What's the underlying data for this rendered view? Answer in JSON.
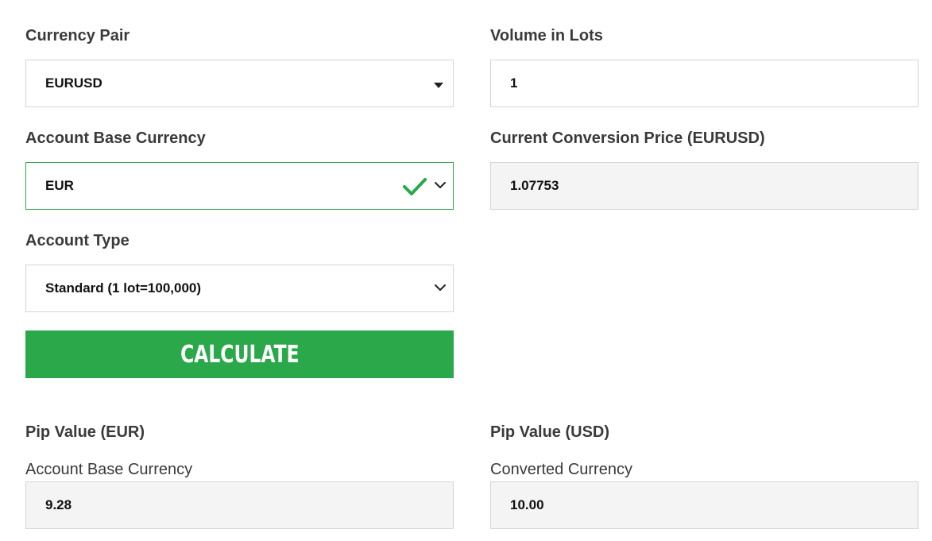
{
  "currency_pair": {
    "label": "Currency Pair",
    "value": "EURUSD",
    "icon": "caret-down-icon"
  },
  "volume_in_lots": {
    "label": "Volume in Lots",
    "value": "1"
  },
  "account_base_currency": {
    "label": "Account Base Currency",
    "value": "EUR",
    "valid_icon": "checkmark-icon",
    "icon": "chevron-down-icon"
  },
  "conversion_price": {
    "label": "Current Conversion Price (EURUSD)",
    "value": "1.07753"
  },
  "account_type": {
    "label": "Account Type",
    "value": "Standard (1 lot=100,000)",
    "icon": "chevron-down-icon"
  },
  "calculate_button": {
    "label": "CALCULATE"
  },
  "pip_value_base": {
    "label": "Pip Value (EUR)",
    "sublabel": "Account Base Currency",
    "value": "9.28"
  },
  "pip_value_converted": {
    "label": "Pip Value (USD)",
    "sublabel": "Converted Currency",
    "value": "10.00"
  },
  "colors": {
    "accent_green": "#2aa84a",
    "border": "#d4d4d4",
    "readonly_bg": "#f4f4f4",
    "label_text": "#3a3a3a"
  }
}
